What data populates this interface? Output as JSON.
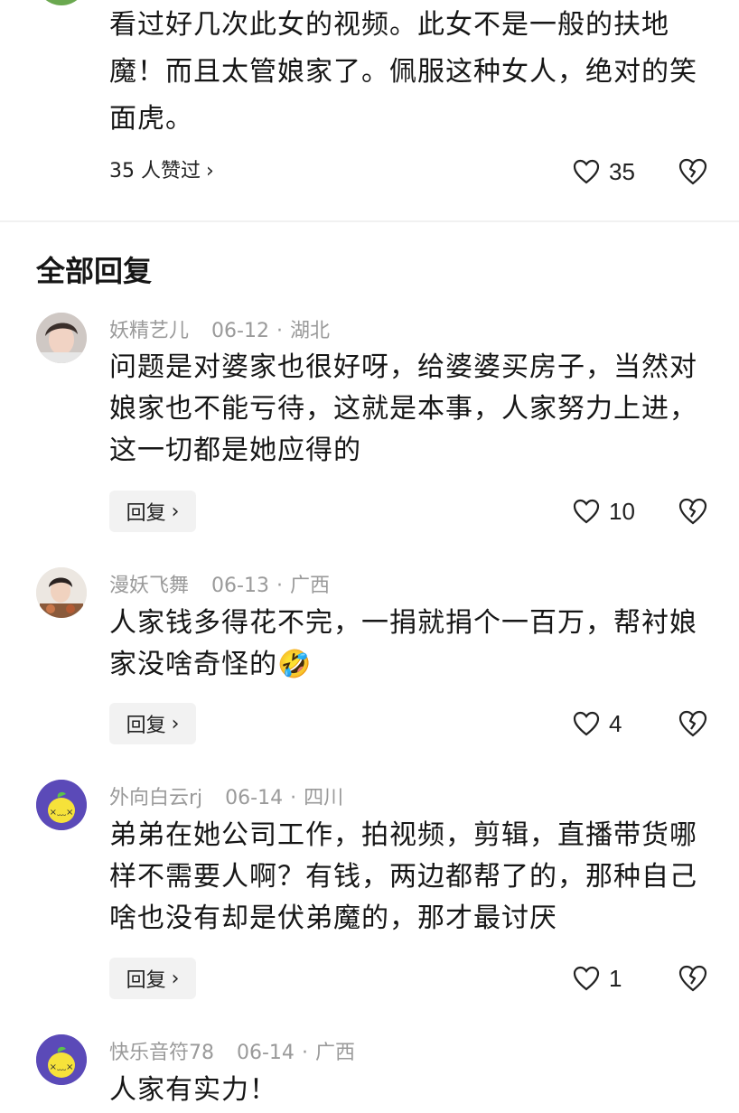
{
  "main_comment": {
    "text": "看过好几次此女的视频。此女不是一般的扶地魔！而且太管娘家了。佩服这种女人，绝对的笑面虎。",
    "liked_by": "35 人赞过",
    "like_count": "35"
  },
  "section_title": "全部回复",
  "replies": [
    {
      "username": "妖精艺儿",
      "date": "06-12",
      "location": "湖北",
      "text": "问题是对婆家也很好呀，给婆婆买房子，当然对娘家也不能亏待，这就是本事，人家努力上进，这一切都是她应得的",
      "reply_label": "回复",
      "like_count": "10"
    },
    {
      "username": "漫妖飞舞",
      "date": "06-13",
      "location": "广西",
      "text": "人家钱多得花不完，一捐就捐个一百万，帮衬娘家没啥奇怪的🤣",
      "reply_label": "回复",
      "like_count": "4"
    },
    {
      "username": "外向白云rj",
      "date": "06-14",
      "location": "四川",
      "text": "弟弟在她公司工作，拍视频，剪辑，直播带货哪样不需要人啊？有钱，两边都帮了的，那种自己啥也没有却是伏弟魔的，那才最讨厌",
      "reply_label": "回复",
      "like_count": "1"
    },
    {
      "username": "快乐音符78",
      "date": "06-14",
      "location": "广西",
      "text": "人家有实力！"
    }
  ],
  "icons": {
    "like": "heart-outline-icon",
    "dislike": "broken-heart-icon",
    "chevron": "chevron-right-icon"
  },
  "colors": {
    "meta_gray": "#9a9a9a",
    "reply_button_bg": "#f2f2f2",
    "lemon_avatar_bg": "#5b4ab8",
    "lemon_yellow": "#f6e23a"
  }
}
